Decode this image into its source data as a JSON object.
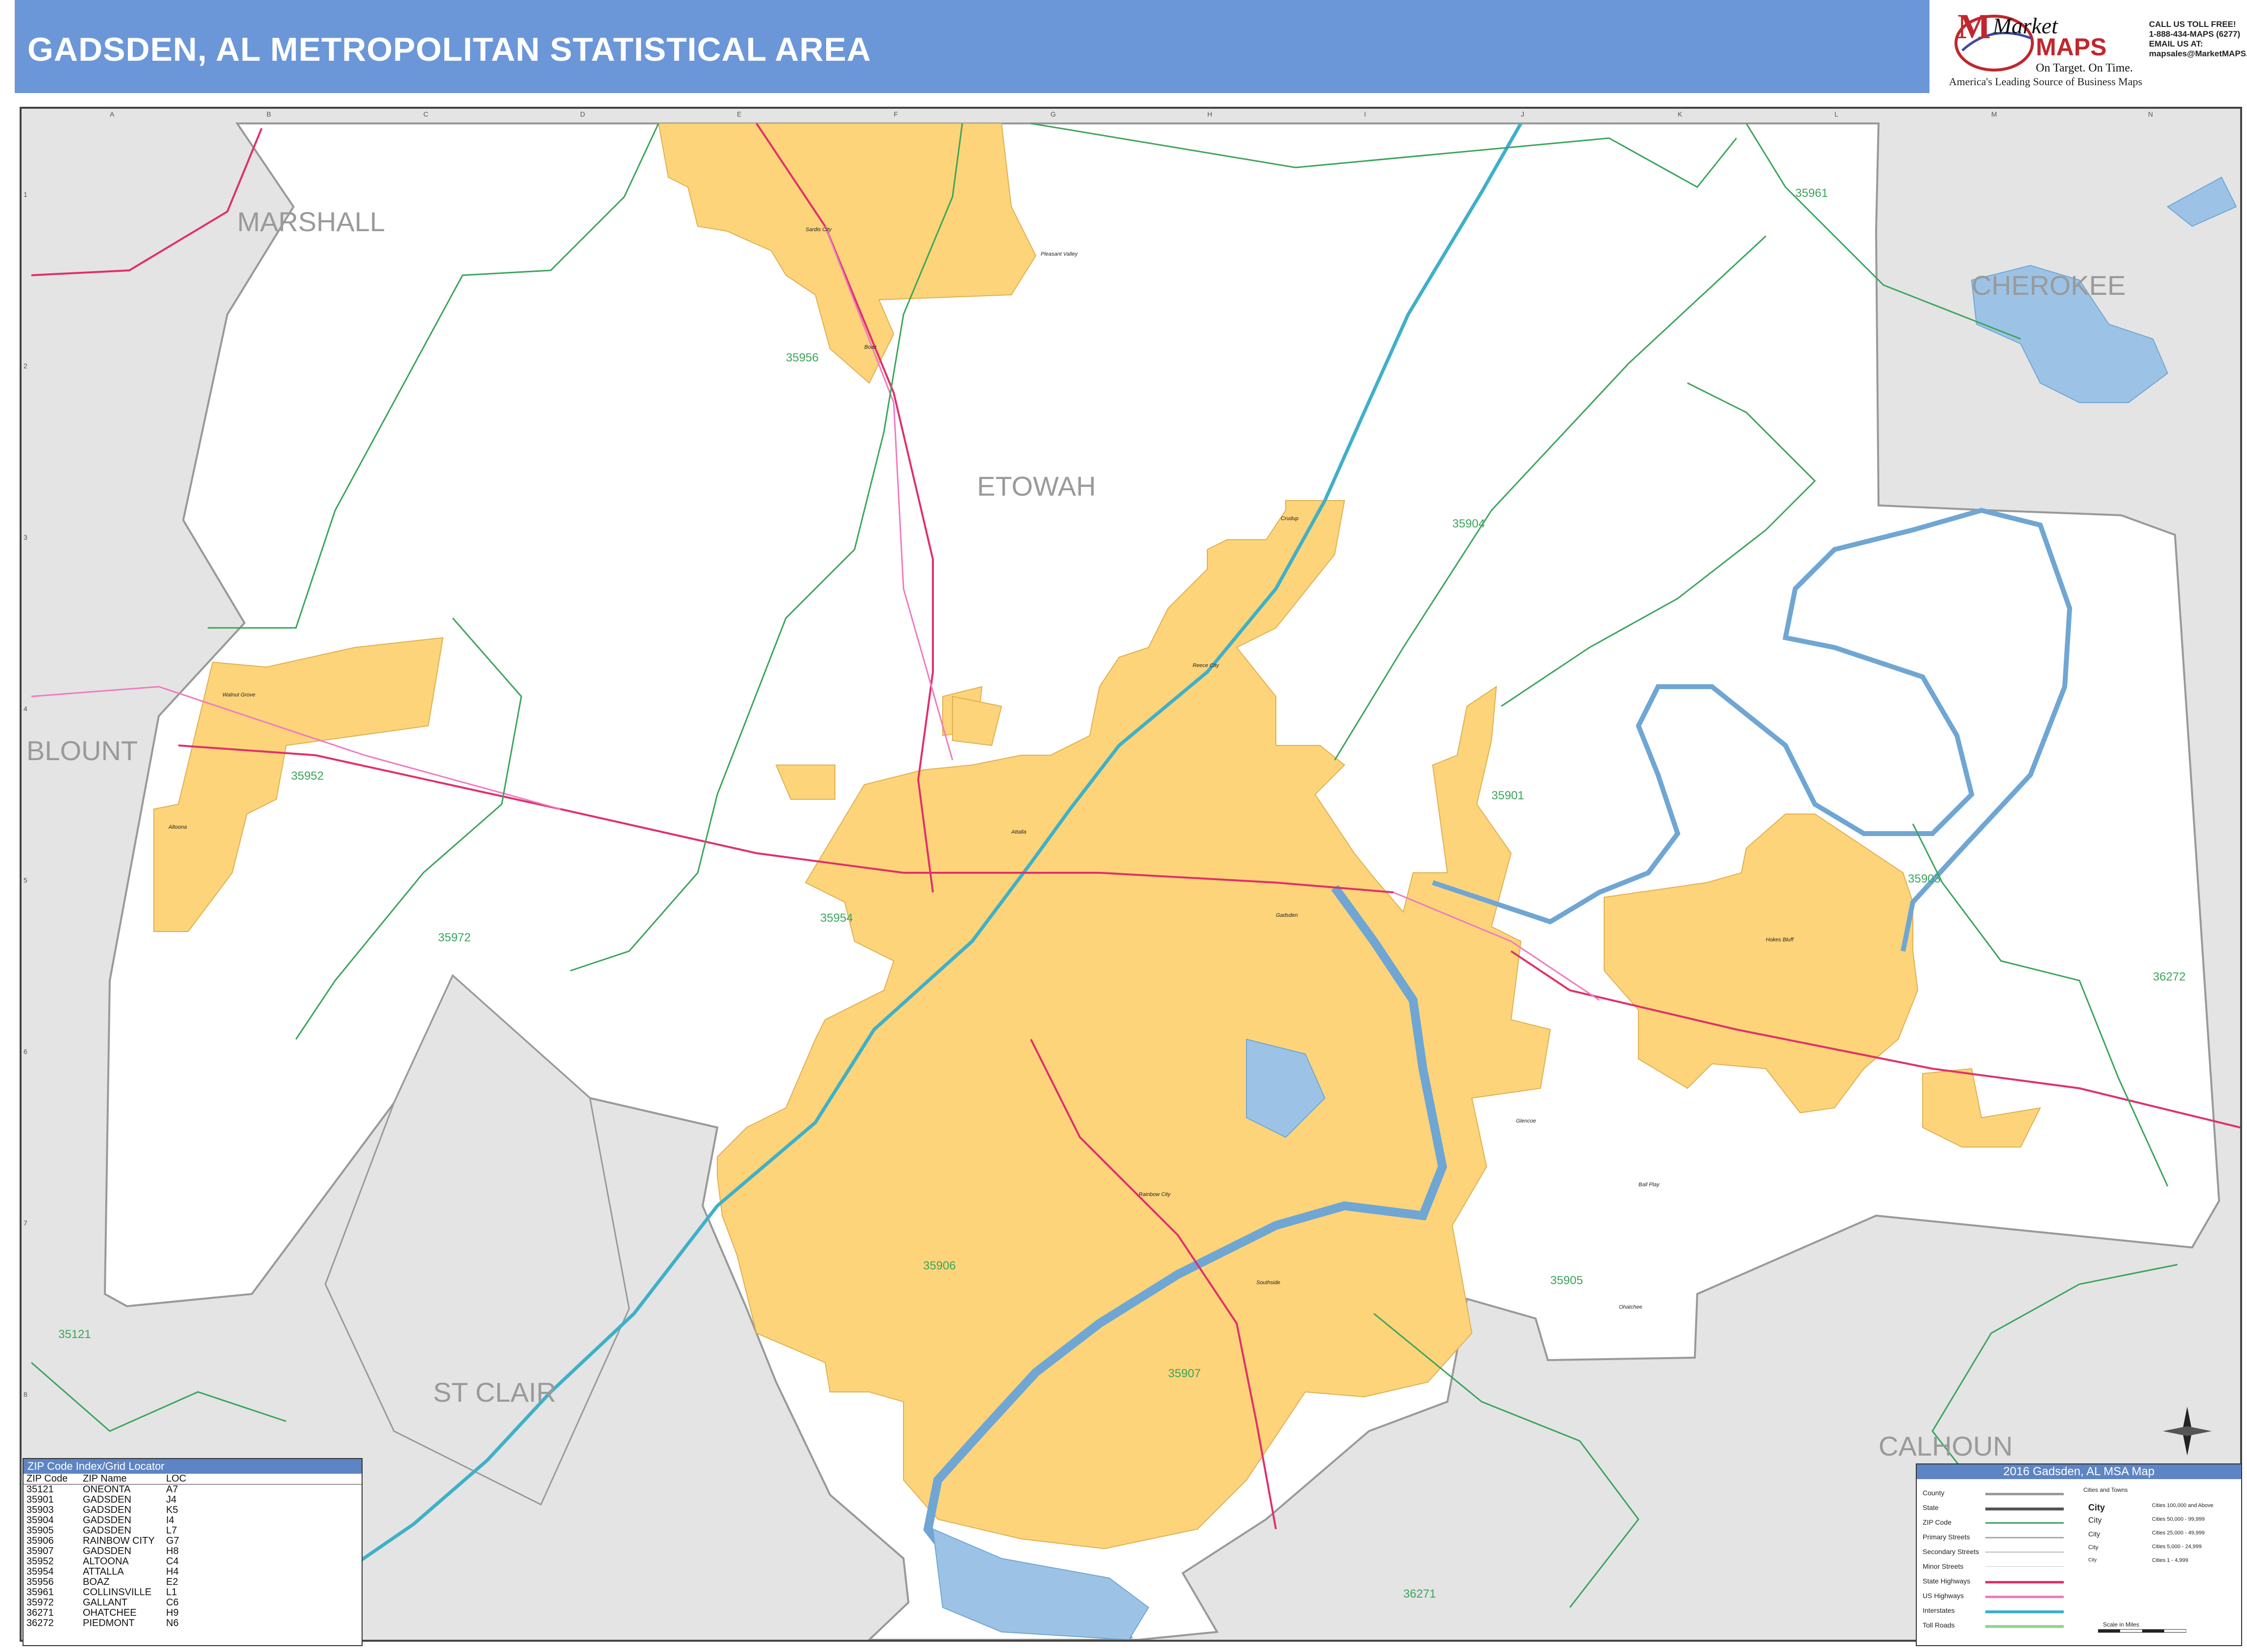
{
  "title": "GADSDEN, AL METROPOLITAN STATISTICAL AREA",
  "brand": {
    "name_line1": "Market",
    "name_line2": "MAPS",
    "slogan": "On Target. On Time.",
    "tagline": "America's Leading Source of Business Maps",
    "contact": [
      "CALL US TOLL FREE!",
      "1-888-434-MAPS (6277)",
      "EMAIL US AT:",
      "mapsales@MarketMAPS.com"
    ]
  },
  "grid_columns": [
    "A",
    "B",
    "C",
    "D",
    "E",
    "F",
    "G",
    "H",
    "I",
    "J",
    "K",
    "L",
    "M",
    "N"
  ],
  "grid_rows": [
    "1",
    "2",
    "3",
    "4",
    "5",
    "6",
    "7",
    "8"
  ],
  "county_labels": [
    "MARSHALL",
    "CHEROKEE",
    "ETOWAH",
    "BLOUNT",
    "ST CLAIR",
    "CALHOUN"
  ],
  "zip_labels": [
    "35961",
    "35956",
    "35904",
    "35952",
    "35901",
    "35903",
    "35954",
    "35972",
    "36272",
    "35906",
    "35905",
    "35907",
    "35121",
    "36271"
  ],
  "city_labels": [
    "Sardis City",
    "Boaz",
    "Walnut Grove",
    "Altoona",
    "Reece City",
    "Glencoe",
    "Rainbow City",
    "Southside",
    "Hokes Bluff",
    "Attalla",
    "Gadsden",
    "Ball Play",
    "Ohatchee",
    "Crudup",
    "Pleasant Valley"
  ],
  "zip_index": {
    "title": "ZIP Code Index/Grid Locator",
    "headers": [
      "ZIP Code",
      "ZIP Name",
      "LOC"
    ],
    "rows": [
      [
        "35121",
        "ONEONTA",
        "A7"
      ],
      [
        "35901",
        "GADSDEN",
        "J4"
      ],
      [
        "35903",
        "GADSDEN",
        "K5"
      ],
      [
        "35904",
        "GADSDEN",
        "I4"
      ],
      [
        "35905",
        "GADSDEN",
        "L7"
      ],
      [
        "35906",
        "RAINBOW CITY",
        "G7"
      ],
      [
        "35907",
        "GADSDEN",
        "H8"
      ],
      [
        "35952",
        "ALTOONA",
        "C4"
      ],
      [
        "35954",
        "ATTALLA",
        "H4"
      ],
      [
        "35956",
        "BOAZ",
        "E2"
      ],
      [
        "35961",
        "COLLINSVILLE",
        "L1"
      ],
      [
        "35972",
        "GALLANT",
        "C6"
      ],
      [
        "36271",
        "OHATCHEE",
        "H9"
      ],
      [
        "36272",
        "PIEDMONT",
        "N6"
      ]
    ]
  },
  "legend": {
    "title": "2016 Gadsden, AL MSA Map",
    "items": [
      "County",
      "State",
      "ZIP Code",
      "Primary Streets",
      "Secondary Streets",
      "Minor Streets",
      "State Highways",
      "US Highways",
      "Interstates",
      "Toll Roads"
    ],
    "cities_header": "Cities and Towns",
    "city_sizes": [
      "City",
      "City",
      "City",
      "City",
      "City"
    ],
    "city_pops": [
      "Cities 100,000 and Above",
      "Cities 50,000 - 99,999",
      "Cities 25,000 - 49,999",
      "Cities 5,000 - 24,999",
      "Cities 1 - 4,999"
    ],
    "scale_label": "Scale in Miles"
  },
  "colors": {
    "header": "#6b97d8",
    "incorporated": "#fdd47a",
    "water": "#9cc3e6",
    "zip_boundary": "#3aa55b",
    "state_highway": "#e0306a",
    "us_highway": "#f07ac0",
    "interstate": "#3fb0c8",
    "outside": "#e4e4e4"
  }
}
